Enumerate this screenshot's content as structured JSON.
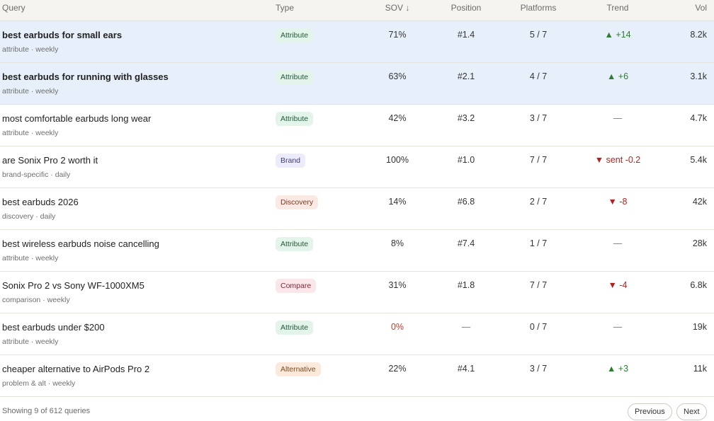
{
  "header": {
    "query": "Query",
    "type": "Type",
    "sov": "SOV ↓",
    "position": "Position",
    "platforms": "Platforms",
    "trend": "Trend",
    "vol": "Vol"
  },
  "rows": [
    {
      "query": "best earbuds for small ears",
      "sub": "attribute · weekly",
      "type": "Attribute",
      "sov": "71%",
      "position": "#1.4",
      "platforms": "5 / 7",
      "trend": "▲ +14",
      "vol": "8.2k"
    },
    {
      "query": "best earbuds for running with glasses",
      "sub": "attribute · weekly",
      "type": "Attribute",
      "sov": "63%",
      "position": "#2.1",
      "platforms": "4 / 7",
      "trend": "▲ +6",
      "vol": "3.1k"
    },
    {
      "query": "most comfortable earbuds long wear",
      "sub": "attribute · weekly",
      "type": "Attribute",
      "sov": "42%",
      "position": "#3.2",
      "platforms": "3 / 7",
      "trend": "—",
      "vol": "4.7k"
    },
    {
      "query": "are Sonix Pro 2 worth it",
      "sub": "brand-specific · daily",
      "type": "Brand",
      "sov": "100%",
      "position": "#1.0",
      "platforms": "7 / 7",
      "trend": "▼ sent -0.2",
      "vol": "5.4k"
    },
    {
      "query": "best earbuds 2026",
      "sub": "discovery · daily",
      "type": "Discovery",
      "sov": "14%",
      "position": "#6.8",
      "platforms": "2 / 7",
      "trend": "▼ -8",
      "vol": "42k"
    },
    {
      "query": "best wireless earbuds noise cancelling",
      "sub": "attribute · weekly",
      "type": "Attribute",
      "sov": "8%",
      "position": "#7.4",
      "platforms": "1 / 7",
      "trend": "—",
      "vol": "28k"
    },
    {
      "query": "Sonix Pro 2 vs Sony WF-1000XM5",
      "sub": "comparison · weekly",
      "type": "Compare",
      "sov": "31%",
      "position": "#1.8",
      "platforms": "7 / 7",
      "trend": "▼ -4",
      "vol": "6.8k"
    },
    {
      "query": "best earbuds under $200",
      "sub": "attribute · weekly",
      "type": "Attribute",
      "sov": "0%",
      "position": "—",
      "platforms": "0 / 7",
      "trend": "—",
      "vol": "19k"
    },
    {
      "query": "cheaper alternative to AirPods Pro 2",
      "sub": "problem & alt · weekly",
      "type": "Alternative",
      "sov": "22%",
      "position": "#4.1",
      "platforms": "3 / 7",
      "trend": "▲ +3",
      "vol": "11k"
    }
  ],
  "footer": {
    "info": "Showing 9 of 612 queries",
    "prev": "Previous",
    "next": "Next"
  },
  "colors": {
    "highlight_row": "#e7f0fa",
    "trend_up": "#2e7d32",
    "trend_down": "#b22222",
    "sov_zero": "#c0392b"
  }
}
